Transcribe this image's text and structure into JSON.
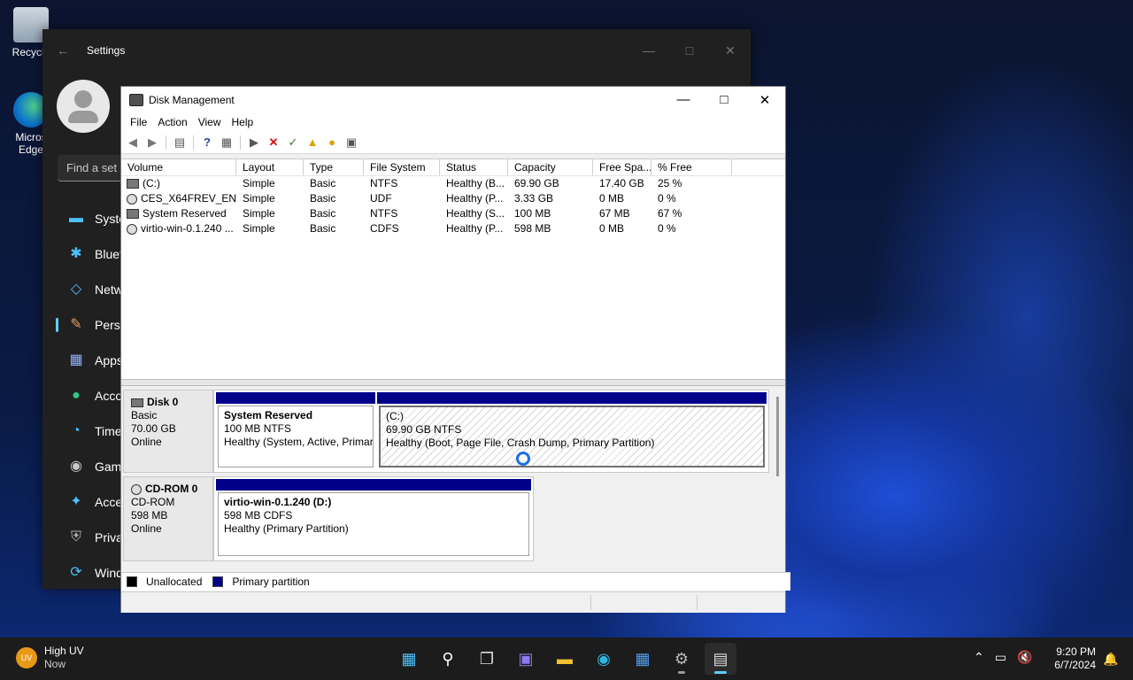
{
  "desktop": {
    "icons": [
      {
        "label": "Recycle"
      },
      {
        "label": "Micros\nEdge"
      }
    ]
  },
  "settings": {
    "title": "Settings",
    "search_placeholder": "Find a set",
    "nav": [
      {
        "label": "Syste",
        "icon": "system-icon"
      },
      {
        "label": "Bluet",
        "icon": "bluetooth-icon"
      },
      {
        "label": "Netw",
        "icon": "network-icon"
      },
      {
        "label": "Perso",
        "icon": "brush-icon"
      },
      {
        "label": "Apps",
        "icon": "apps-icon"
      },
      {
        "label": "Acco",
        "icon": "accounts-icon"
      },
      {
        "label": "Time",
        "icon": "time-icon"
      },
      {
        "label": "Gam",
        "icon": "gaming-icon"
      },
      {
        "label": "Acce",
        "icon": "accessibility-icon"
      },
      {
        "label": "Priva",
        "icon": "privacy-icon"
      },
      {
        "label": "Wind",
        "icon": "update-icon"
      }
    ]
  },
  "disk_mgmt": {
    "title": "Disk Management",
    "menu": [
      "File",
      "Action",
      "View",
      "Help"
    ],
    "columns": [
      "Volume",
      "Layout",
      "Type",
      "File System",
      "Status",
      "Capacity",
      "Free Spa...",
      "% Free"
    ],
    "volumes": [
      [
        "(C:)",
        "Simple",
        "Basic",
        "NTFS",
        "Healthy (B...",
        "69.90 GB",
        "17.40 GB",
        "25 %"
      ],
      [
        "CES_X64FREV_EN-...",
        "Simple",
        "Basic",
        "UDF",
        "Healthy (P...",
        "3.33 GB",
        "0 MB",
        "0 %"
      ],
      [
        "System Reserved",
        "Simple",
        "Basic",
        "NTFS",
        "Healthy (S...",
        "100 MB",
        "67 MB",
        "67 %"
      ],
      [
        "virtio-win-0.1.240 ...",
        "Simple",
        "Basic",
        "CDFS",
        "Healthy (P...",
        "598 MB",
        "0 MB",
        "0 %"
      ]
    ],
    "disks": [
      {
        "name": "Disk 0",
        "type": "Basic",
        "size": "70.00 GB",
        "state": "Online",
        "partitions": [
          {
            "name": "System Reserved",
            "size": "100 MB NTFS",
            "status": "Healthy (System, Active, Primar"
          },
          {
            "name": "(C:)",
            "size": "69.90 GB NTFS",
            "status": "Healthy (Boot, Page File, Crash Dump, Primary Partition)"
          }
        ]
      },
      {
        "name": "CD-ROM 0",
        "type": "CD-ROM",
        "size": "598 MB",
        "state": "Online",
        "partitions": [
          {
            "name": "virtio-win-0.1.240  (D:)",
            "size": "598 MB CDFS",
            "status": "Healthy (Primary Partition)"
          }
        ]
      }
    ],
    "legend": [
      "Unallocated",
      "Primary partition"
    ],
    "colors": {
      "unallocated": "#000000",
      "primary": "#00008b"
    }
  },
  "taskbar": {
    "weather_title": "High UV",
    "weather_sub": "Now",
    "weather_badge": "UV",
    "time": "9:20 PM",
    "date": "6/7/2024"
  }
}
